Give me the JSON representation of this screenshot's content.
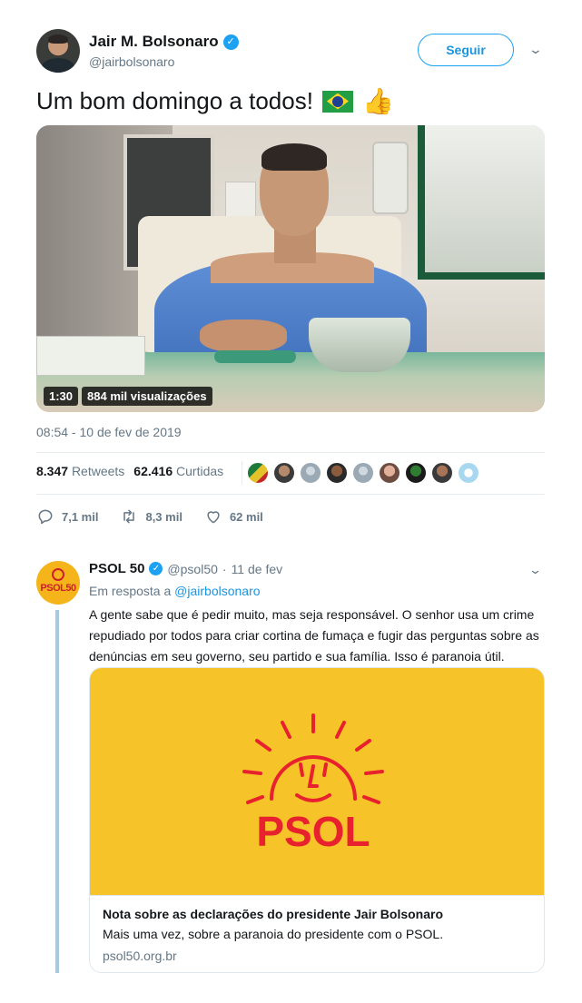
{
  "tweet": {
    "author_name": "Jair M. Bolsonaro",
    "handle": "@jairbolsonaro",
    "follow_label": "Seguir",
    "text": "Um bom domingo a todos!",
    "emoji": [
      "brazil-flag",
      "thumbs-up"
    ],
    "video": {
      "duration": "1:30",
      "views": "884 mil visualizações"
    },
    "timestamp": "08:54 - 10 de fev de 2019",
    "stats": {
      "retweets_count": "8.347",
      "retweets_label": "Retweets",
      "likes_count": "62.416",
      "likes_label": "Curtidas"
    },
    "actions": {
      "replies": "7,1 mil",
      "retweets": "8,3 mil",
      "likes": "62 mil"
    }
  },
  "reply": {
    "author_name": "PSOL 50",
    "handle": "@psol50",
    "date": "11 de fev",
    "separator": "·",
    "avatar_text": "PSOL50",
    "in_reply_label": "Em resposta a",
    "in_reply_handle": "@jairbolsonaro",
    "text": "A gente sabe que é pedir muito, mas seja responsável. O senhor usa um crime repudiado por todos para criar cortina de fumaça e fugir das perguntas sobre as denúncias em seu governo, seu partido e sua família. Isso é paranoia útil.",
    "card": {
      "logo_text": "PSOL",
      "title": "Nota sobre as declarações do presidente Jair Bolsonaro",
      "description": "Mais uma vez, sobre a paranoia do presidente com o PSOL.",
      "domain": "psol50.org.br"
    }
  },
  "colors": {
    "twitter_blue": "#1da1f2",
    "psol_yellow": "#f6c328",
    "psol_red": "#e8212e",
    "thread_line": "#a7c9e2"
  }
}
